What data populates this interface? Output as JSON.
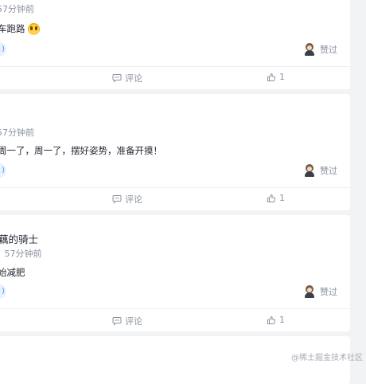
{
  "posts": [
    {
      "author_name": "",
      "time": "57分钟前",
      "content": "车跑路",
      "emoji_icon": "face-screaming-emoji",
      "liked_label": "赞过",
      "comment_label": "评论",
      "like_count": "1"
    },
    {
      "author_name": "",
      "time": "57分钟前",
      "content": "周一了，周一了，摆好姿势，准备开摸！",
      "liked_label": "赞过",
      "comment_label": "评论",
      "like_count": "1"
    },
    {
      "author_name": "藕的骑士",
      "time": "57分钟前",
      "content": "始减肥",
      "liked_label": "赞过",
      "comment_label": "评论",
      "like_count": "1"
    }
  ],
  "topic_tag_glyph": "⟩",
  "watermark": "@稀土掘金技术社区",
  "colors": {
    "page_background": "#f2f3f5",
    "card_background": "#ffffff",
    "muted_text": "#8a919f",
    "topic_tag_background": "#e8f3ff",
    "topic_tag_text": "#1e80ff"
  }
}
